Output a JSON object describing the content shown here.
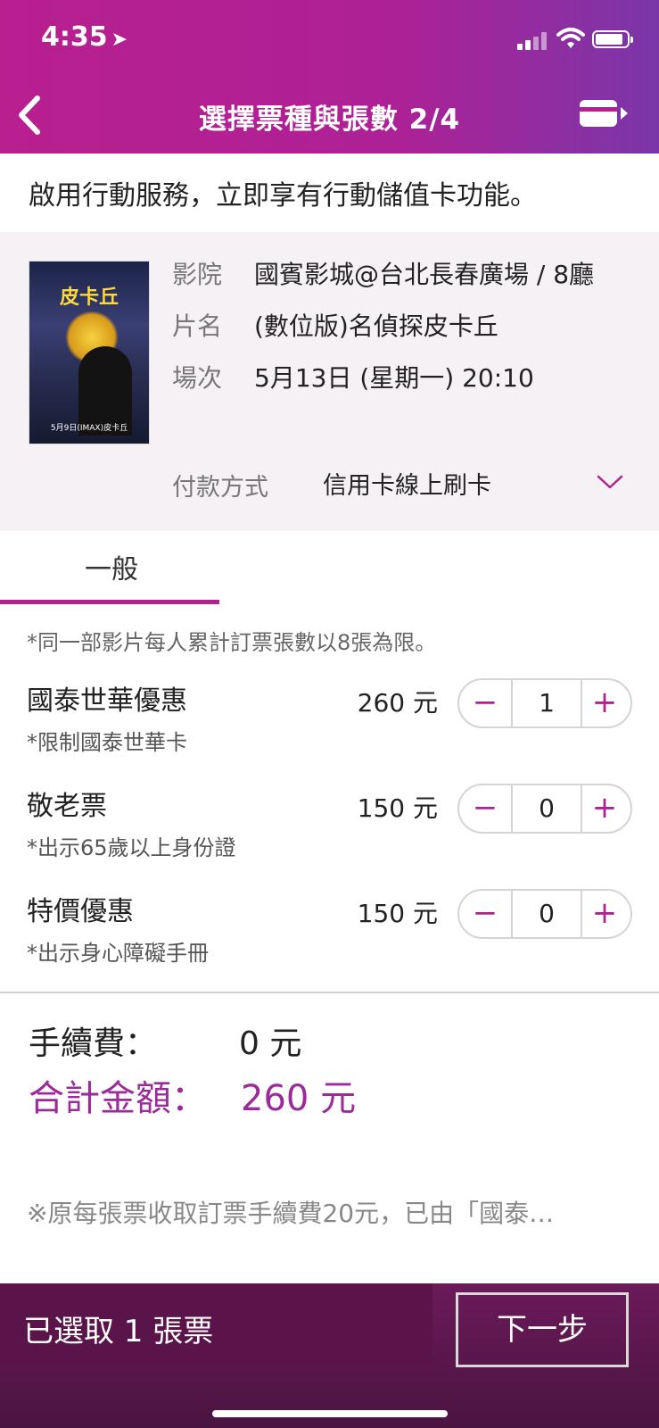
{
  "status_bar": {
    "time": "4:35",
    "location_icon": "location-arrow-icon"
  },
  "header": {
    "title": "選擇票種與張數 2/4",
    "back_icon": "back-chevron-icon",
    "right_icon": "card-forward-icon"
  },
  "notice": {
    "text": "啟用行動服務，立即享有行動儲值卡功能。"
  },
  "movie": {
    "poster_title": "皮卡丘",
    "poster_date": "5月9日(IMAX)皮卡丘",
    "cinema_label": "影院",
    "cinema_value": "國賓影城@台北長春廣場 / 8廳",
    "title_label": "片名",
    "title_value": "(數位版)名偵探皮卡丘",
    "session_label": "場次",
    "session_value": "5月13日 (星期一) 20:10",
    "payment_label": "付款方式",
    "payment_value": "信用卡線上刷卡"
  },
  "tabs": [
    {
      "label": "一般",
      "active": true
    }
  ],
  "limit_note": "*同一部影片每人累計訂票張數以8張為限。",
  "tickets": [
    {
      "name": "國泰世華優惠",
      "sub": "*限制國泰世華卡",
      "price": "260 元",
      "qty": "1"
    },
    {
      "name": "敬老票",
      "sub": "*出示65歲以上身份證",
      "price": "150 元",
      "qty": "0"
    },
    {
      "name": "特價優惠",
      "sub": "*出示身心障礙手冊",
      "price": "150 元",
      "qty": "0"
    }
  ],
  "stepper": {
    "minus": "−",
    "plus": "+"
  },
  "fee": {
    "label": "手續費：",
    "amount": "0 元"
  },
  "total": {
    "label": "合計金額：",
    "amount": "260 元"
  },
  "footnote": "※原每張票收取訂票手續費20元，已由「國泰…",
  "bottom": {
    "selected": "已選取 1 張票",
    "next": "下一步"
  },
  "colors": {
    "brand": "#b0228f",
    "total_text": "#9b2a9a",
    "bottom_bar": "#5b1449"
  }
}
